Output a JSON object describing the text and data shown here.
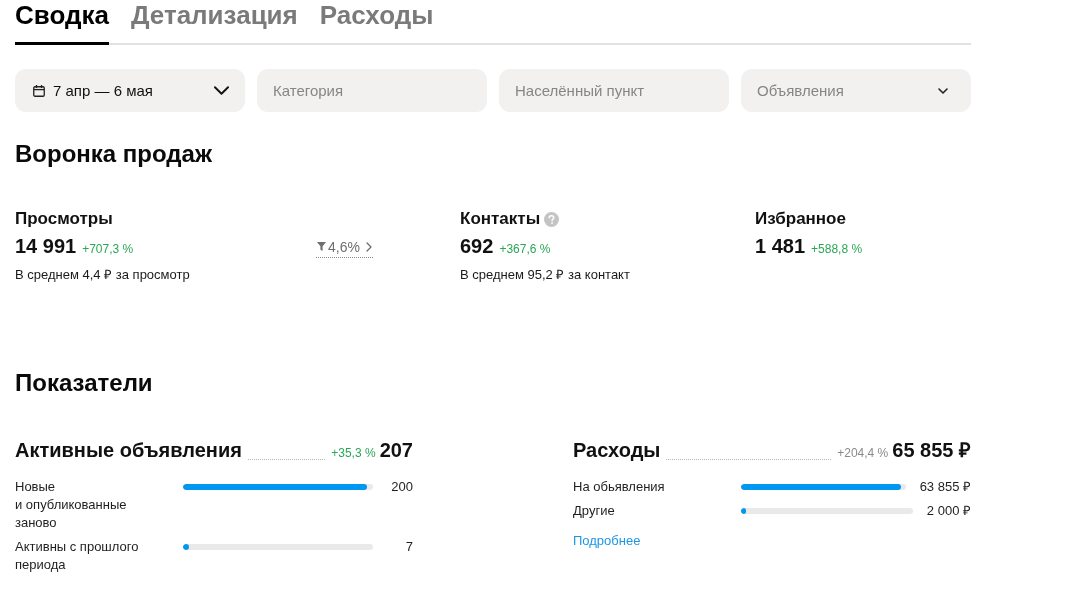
{
  "tabs": [
    {
      "label": "Сводка",
      "selected": true
    },
    {
      "label": "Детализация",
      "selected": false
    },
    {
      "label": "Расходы",
      "selected": false
    }
  ],
  "filters": [
    {
      "kind": "date",
      "value": "7 апр — 6 мая"
    },
    {
      "kind": "input",
      "placeholder": "Категория"
    },
    {
      "kind": "input",
      "placeholder": "Населённый пункт"
    },
    {
      "kind": "select",
      "placeholder": "Объявления"
    }
  ],
  "funnel": {
    "title": "Воронка продаж",
    "stages": [
      {
        "title": "Просмотры",
        "help": false,
        "value": "14 991",
        "change": "+707,3 %",
        "note": "В среднем 4,4 ₽ за просмотр",
        "conversion": "4,6%"
      },
      {
        "title": "Контакты",
        "help": true,
        "value": "692",
        "change": "+367,6 %",
        "note": "В среднем 95,2 ₽ за контакт"
      },
      {
        "title": "Избранное",
        "help": false,
        "value": "1 481",
        "change": "+588,8 %"
      }
    ]
  },
  "indicators": {
    "title": "Показатели",
    "blocks": [
      {
        "title": "Активные объявления",
        "change": "+35,3 %",
        "favorable": true,
        "total": "207",
        "rows": [
          {
            "label": "Новые и опубликованные заново",
            "level": 0.966,
            "value": "200"
          },
          {
            "label": "Активны с прошлого периода",
            "level": 0.034,
            "value": "7"
          }
        ]
      },
      {
        "title": "Расходы",
        "change": "+204,4 %",
        "favorable": false,
        "total": "65 855 ₽",
        "rows": [
          {
            "label": "На обьявления",
            "level": 0.97,
            "value": "63 855 ₽"
          },
          {
            "label": "Другие",
            "level": 0.03,
            "value": "2 000 ₽"
          }
        ],
        "link": "Подробнее"
      }
    ]
  }
}
